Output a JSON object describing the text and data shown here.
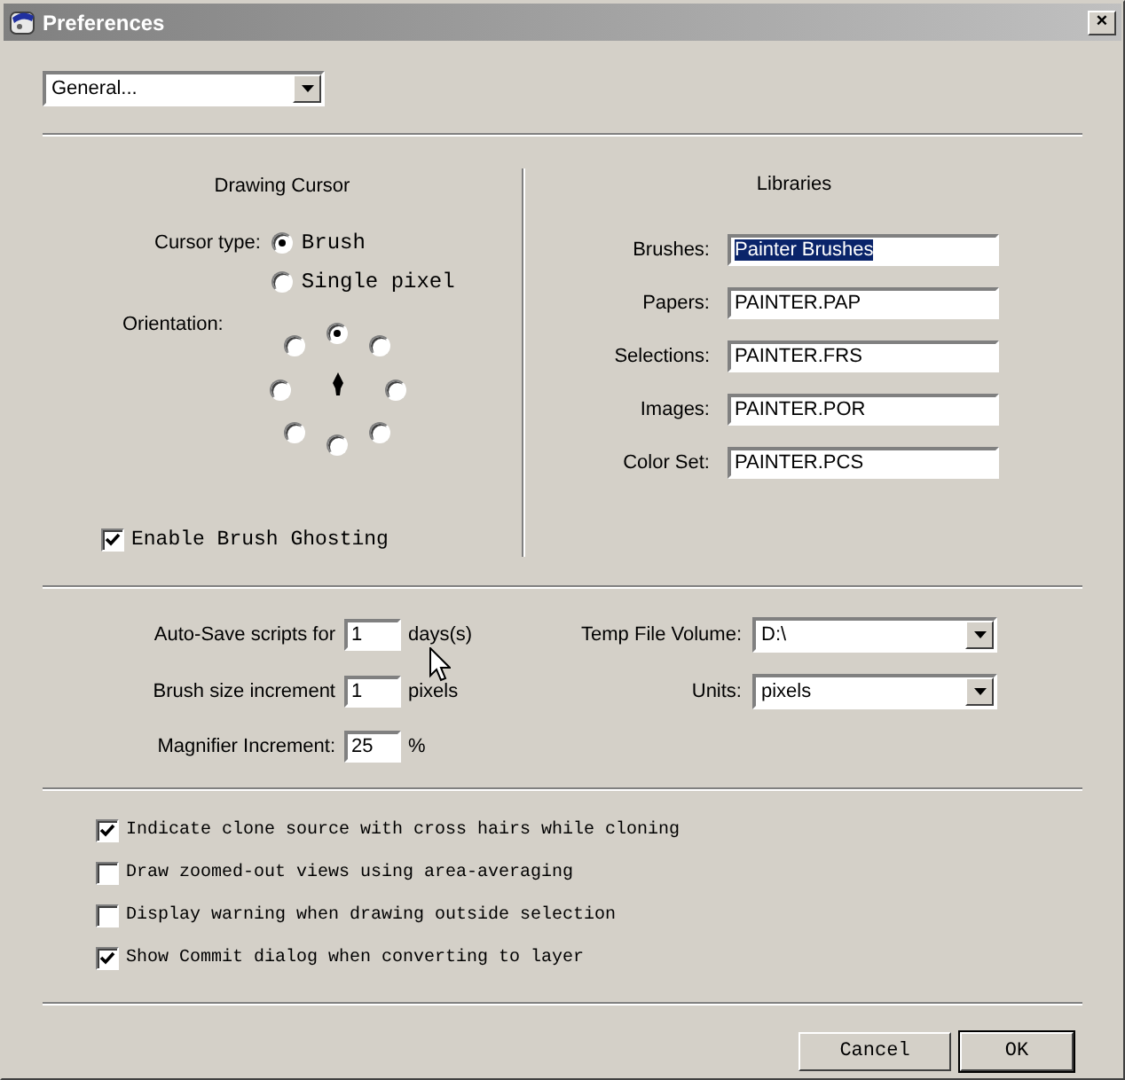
{
  "window": {
    "title": "Preferences",
    "close": "×"
  },
  "category": {
    "value": "General..."
  },
  "drawing_cursor": {
    "title": "Drawing Cursor",
    "cursor_type_label": "Cursor type:",
    "cursor_types": [
      {
        "label": "Brush",
        "selected": true
      },
      {
        "label": "Single pixel",
        "selected": false
      }
    ],
    "orientation_label": "Orientation:",
    "orientations": [
      {
        "selected": true
      },
      {
        "selected": false
      },
      {
        "selected": false
      },
      {
        "selected": false
      },
      {
        "selected": false
      },
      {
        "selected": false
      },
      {
        "selected": false
      },
      {
        "selected": false
      }
    ],
    "ghosting": {
      "label": "Enable Brush Ghosting",
      "checked": true
    }
  },
  "libraries": {
    "title": "Libraries",
    "items": [
      {
        "label": "Brushes:",
        "value": "Painter Brushes",
        "selected": true
      },
      {
        "label": "Papers:",
        "value": "PAINTER.PAP",
        "selected": false
      },
      {
        "label": "Selections:",
        "value": "PAINTER.FRS",
        "selected": false
      },
      {
        "label": "Images:",
        "value": "PAINTER.POR",
        "selected": false
      },
      {
        "label": "Color Set:",
        "value": "PAINTER.PCS",
        "selected": false
      }
    ]
  },
  "settings": [
    {
      "label": "Auto-Save scripts for",
      "value": "1",
      "unit": "days(s)"
    },
    {
      "label": "Brush size increment",
      "value": "1",
      "unit": "pixels"
    },
    {
      "label": "Magnifier Increment:",
      "value": "25",
      "unit": "%"
    }
  ],
  "selects": [
    {
      "label": "Temp File Volume:",
      "value": "D:\\"
    },
    {
      "label": "Units:",
      "value": "pixels"
    }
  ],
  "options": [
    {
      "label": "Indicate clone source with cross hairs while cloning",
      "checked": true
    },
    {
      "label": "Draw zoomed-out views using area-averaging",
      "checked": false
    },
    {
      "label": "Display warning when drawing outside selection",
      "checked": false
    },
    {
      "label": "Show Commit dialog when converting to layer",
      "checked": true
    }
  ],
  "buttons": [
    {
      "label": "Cancel",
      "default": false
    },
    {
      "label": "OK",
      "default": true
    }
  ]
}
